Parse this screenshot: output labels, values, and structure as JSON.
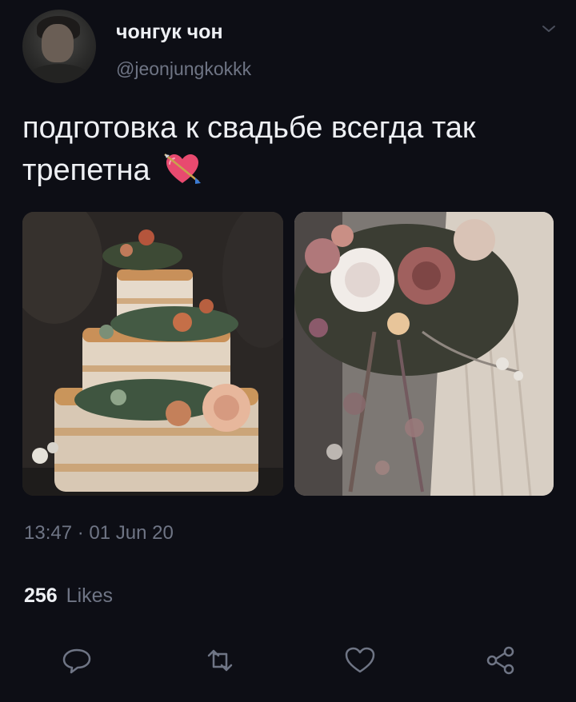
{
  "author": {
    "display_name": "чонгук чон",
    "handle": "@jeonjungkokkk"
  },
  "tweet": {
    "text": "подготовка к свадьбе всегда так трепетна",
    "emoji": "heart-with-arrow"
  },
  "media": [
    {
      "subject": "wedding-cake"
    },
    {
      "subject": "bridal-bouquet"
    }
  ],
  "meta": {
    "timestamp": "13:47 · 01 Jun 20"
  },
  "stats": {
    "likes_count": "256",
    "likes_label": "Likes"
  },
  "actions": [
    {
      "icon": "reply-icon"
    },
    {
      "icon": "retweet-icon"
    },
    {
      "icon": "like-icon"
    },
    {
      "icon": "share-icon"
    }
  ],
  "colors": {
    "background": "#0d0e15",
    "primary_text": "#eef0f4",
    "secondary_text": "#6f7585"
  }
}
